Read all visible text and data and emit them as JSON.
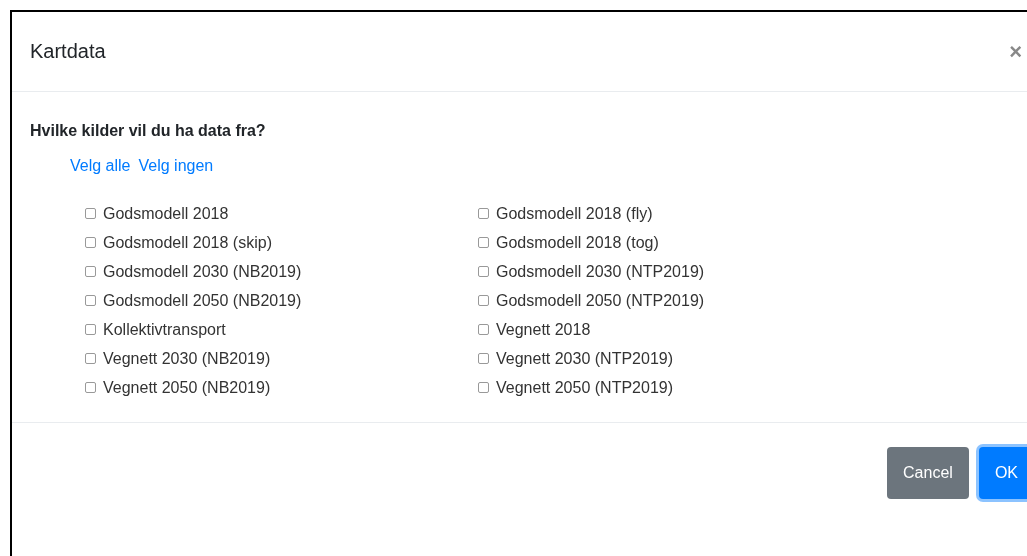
{
  "dialog": {
    "title": "Kartdata",
    "close": "×"
  },
  "question": "Hvilke kilder vil du ha data fra?",
  "links": [
    "Velg alle",
    "Velg ingen"
  ],
  "sources": [
    {
      "label": "Godsmodell 2018",
      "checked": false
    },
    {
      "label": "Godsmodell 2018 (fly)",
      "checked": false
    },
    {
      "label": "Godsmodell 2018 (skip)",
      "checked": false
    },
    {
      "label": "Godsmodell 2018 (tog)",
      "checked": false
    },
    {
      "label": "Godsmodell 2030 (NB2019)",
      "checked": false
    },
    {
      "label": "Godsmodell 2030 (NTP2019)",
      "checked": false
    },
    {
      "label": "Godsmodell 2050 (NB2019)",
      "checked": false
    },
    {
      "label": "Godsmodell 2050 (NTP2019)",
      "checked": false
    },
    {
      "label": "Kollektivtransport",
      "checked": false
    },
    {
      "label": "Vegnett 2018",
      "checked": false
    },
    {
      "label": "Vegnett 2030 (NB2019)",
      "checked": false
    },
    {
      "label": "Vegnett 2030 (NTP2019)",
      "checked": false
    },
    {
      "label": "Vegnett 2050 (NB2019)",
      "checked": false
    },
    {
      "label": "Vegnett 2050 (NTP2019)",
      "checked": false
    }
  ],
  "buttons": [
    {
      "label": "Cancel",
      "kind": "secondary"
    },
    {
      "label": "OK",
      "kind": "primary"
    }
  ]
}
